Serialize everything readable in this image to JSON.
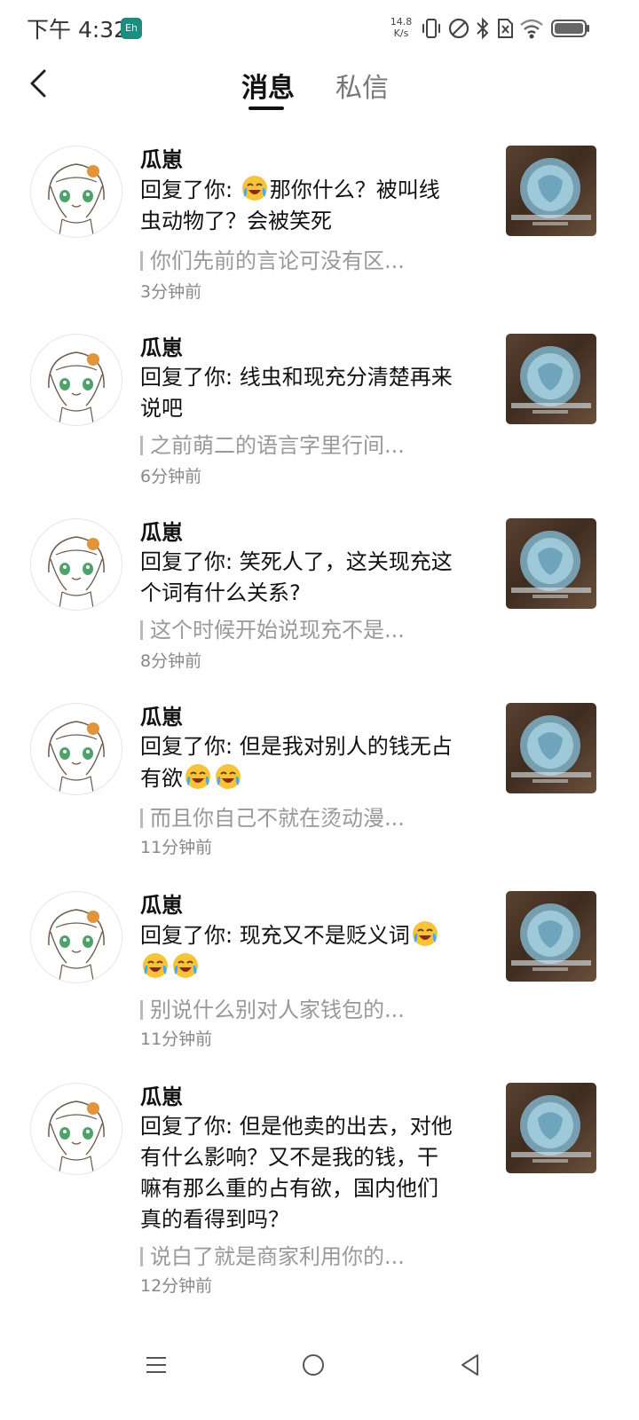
{
  "status_bar": {
    "time": "下午 4:32",
    "app_badge": "Eh",
    "net_speed_value": "14.8",
    "net_speed_unit": "K/s",
    "icons": [
      "vibrate-icon",
      "dnd-icon",
      "bluetooth-icon",
      "no-sim-icon",
      "wifi-icon",
      "battery-icon"
    ]
  },
  "header": {
    "back_icon": "back-arrow-icon",
    "tabs": [
      {
        "label": "消息",
        "active": true
      },
      {
        "label": "私信",
        "active": false
      }
    ]
  },
  "messages": [
    {
      "user": "瓜崽",
      "reply_prefix": "回复了你: ",
      "line1": "那你什么？被叫线",
      "line2": "虫动物了？会被笑死",
      "emoji_line1_before": 1,
      "quote": "你们先前的言论可没有区...",
      "time": "3分钟前"
    },
    {
      "user": "瓜崽",
      "reply_prefix": "回复了你: ",
      "line1": "线虫和现充分清楚再来",
      "line2": "说吧",
      "quote": "之前萌二的语言字里行间...",
      "time": "6分钟前"
    },
    {
      "user": "瓜崽",
      "reply_prefix": "回复了你: ",
      "line1": "笑死人了，这关现充这",
      "line2": "个词有什么关系?",
      "quote": "这个时候开始说现充不是...",
      "time": "8分钟前"
    },
    {
      "user": "瓜崽",
      "reply_prefix": "回复了你: ",
      "line1": "但是我对别人的钱无占",
      "line2": "有欲",
      "emoji_line2_after": 2,
      "quote": "而且你自己不就在烫动漫...",
      "time": "11分钟前"
    },
    {
      "user": "瓜崽",
      "reply_prefix": "回复了你: ",
      "line1": "现充又不是贬义词",
      "emoji_line1_after": 1,
      "emoji_line2": 2,
      "quote": "别说什么别对人家钱包的...",
      "time": "11分钟前"
    },
    {
      "user": "瓜崽",
      "reply_prefix": "回复了你: ",
      "line1": "但是他卖的出去，对他",
      "line2": "有什么影响？又不是我的钱，干",
      "line3": "嘛有那么重的占有欲，国内他们",
      "line4": "真的看得到吗？",
      "quote": "说白了就是商家利用你的...",
      "time": "12分钟前"
    }
  ],
  "nav_bar": {
    "icons": [
      "menu-icon",
      "home-icon",
      "back-triangle-icon"
    ]
  },
  "colors": {
    "primary_text": "#111111",
    "secondary_text": "#999999",
    "time_text": "#888888",
    "badge": "#1e8c7e"
  }
}
